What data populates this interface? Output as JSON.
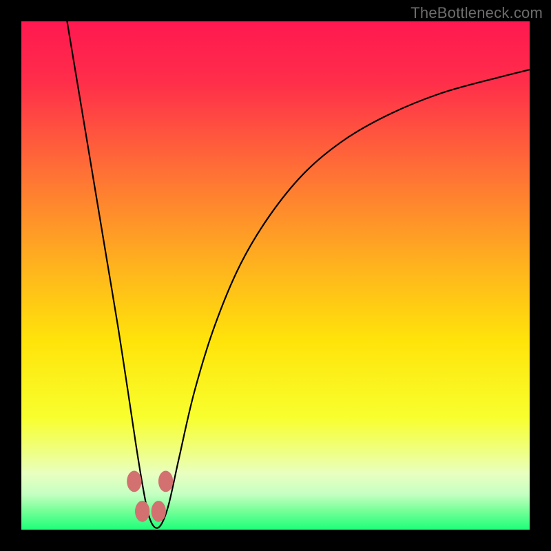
{
  "watermark": "TheBottleneck.com",
  "chart_data": {
    "type": "line",
    "title": "",
    "xlabel": "",
    "ylabel": "",
    "xlim": [
      0,
      100
    ],
    "ylim": [
      0,
      100
    ],
    "grid": false,
    "legend": false,
    "background": {
      "type": "vertical-gradient",
      "stops": [
        {
          "pct": 0,
          "color": "#ff1850"
        },
        {
          "pct": 12,
          "color": "#ff2e4a"
        },
        {
          "pct": 30,
          "color": "#ff7235"
        },
        {
          "pct": 48,
          "color": "#ffb21e"
        },
        {
          "pct": 63,
          "color": "#ffe40a"
        },
        {
          "pct": 78,
          "color": "#f8ff2e"
        },
        {
          "pct": 84,
          "color": "#f0ff7a"
        },
        {
          "pct": 89,
          "color": "#e8ffc0"
        },
        {
          "pct": 93,
          "color": "#c6ffc3"
        },
        {
          "pct": 96,
          "color": "#7dff9b"
        },
        {
          "pct": 100,
          "color": "#1dff79"
        }
      ]
    },
    "series": [
      {
        "name": "bottleneck-curve",
        "color": "#000000",
        "x": [
          9.0,
          11.0,
          13.0,
          15.0,
          17.0,
          19.0,
          21.0,
          22.5,
          23.8,
          25.0,
          26.2,
          27.5,
          29.0,
          31.0,
          34.0,
          38.0,
          43.0,
          49.0,
          56.0,
          64.0,
          73.0,
          83.0,
          94.0,
          100.0
        ],
        "y": [
          100.0,
          88.0,
          76.0,
          64.0,
          52.0,
          40.0,
          27.0,
          17.0,
          9.0,
          3.0,
          0.5,
          1.0,
          5.0,
          14.0,
          27.0,
          40.0,
          52.0,
          62.0,
          70.5,
          77.0,
          82.0,
          86.0,
          89.0,
          90.5
        ]
      }
    ],
    "markers": [
      {
        "name": "marker-left-upper",
        "x": 22.2,
        "y": 9.5,
        "color": "#d37070",
        "r": 1.6
      },
      {
        "name": "marker-right-upper",
        "x": 28.4,
        "y": 9.5,
        "color": "#d37070",
        "r": 1.6
      },
      {
        "name": "marker-left-lower",
        "x": 23.8,
        "y": 3.6,
        "color": "#d37070",
        "r": 1.6
      },
      {
        "name": "marker-right-lower",
        "x": 27.0,
        "y": 3.6,
        "color": "#d37070",
        "r": 1.6
      }
    ]
  }
}
